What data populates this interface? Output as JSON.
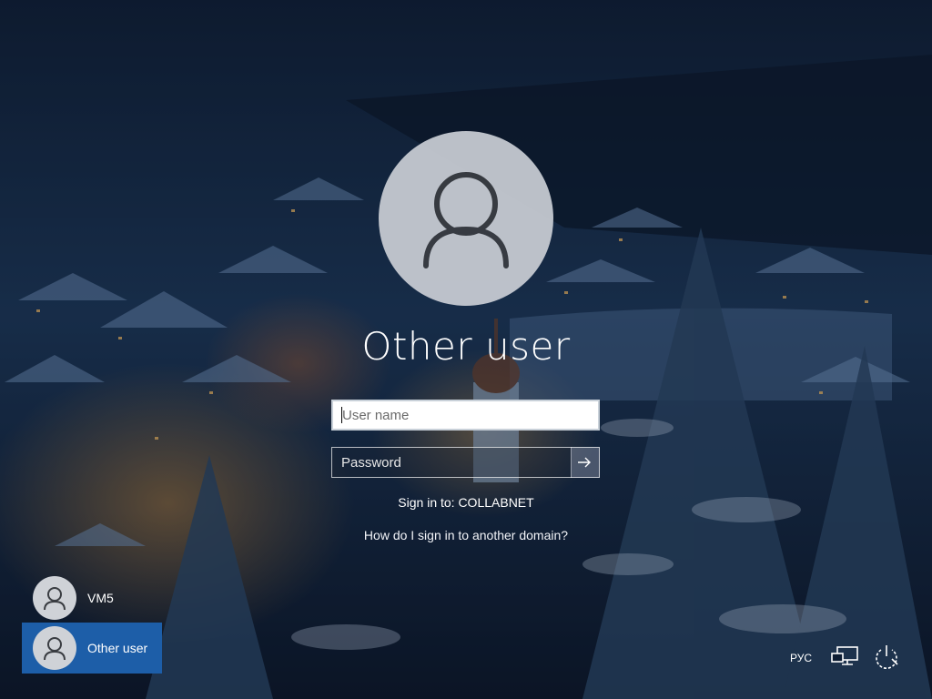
{
  "login": {
    "title": "Other user",
    "username_placeholder": "User name",
    "password_placeholder": "Password",
    "sign_in_to": "Sign in to: COLLABNET",
    "other_domain_link": "How do I sign in to another domain?"
  },
  "users": [
    {
      "label": "VM5",
      "icon": "user-icon",
      "selected": false
    },
    {
      "label": "Other user",
      "icon": "user-icon",
      "selected": true
    }
  ],
  "tray": {
    "language": "РУС",
    "icons": [
      "network-icon",
      "power-icon"
    ]
  },
  "colors": {
    "selected_tile": "#1d5ea8",
    "avatar_bg": "#c9cdd4",
    "icon_stroke": "#3a3d42"
  }
}
